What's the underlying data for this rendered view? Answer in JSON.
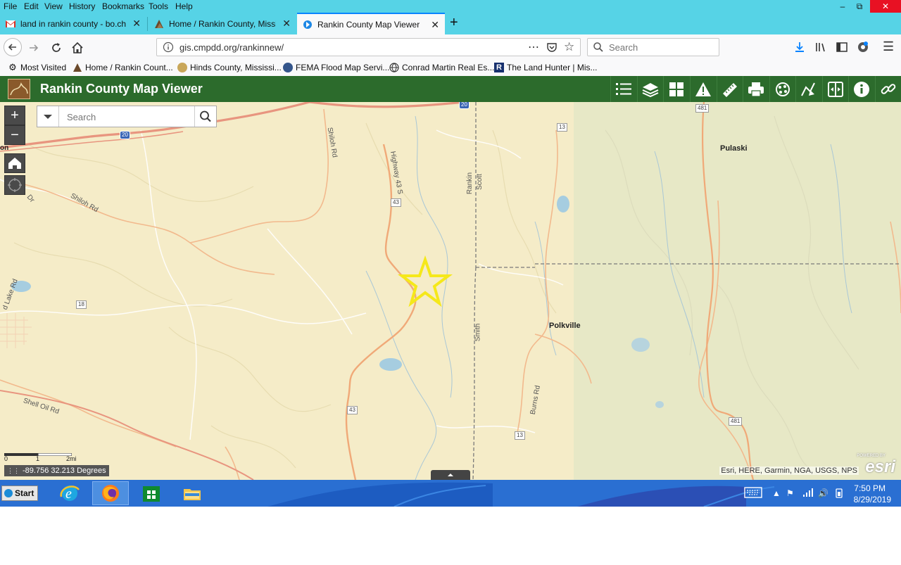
{
  "menubar": {
    "items": [
      "File",
      "Edit",
      "View",
      "History",
      "Bookmarks",
      "Tools",
      "Help"
    ]
  },
  "tabs": [
    {
      "title": "land in rankin county - bo.char",
      "favicon": "gmail-icon",
      "active": false
    },
    {
      "title": "Home / Rankin County, Mississ",
      "favicon": "landwatch-icon",
      "active": false
    },
    {
      "title": "Rankin County Map Viewer",
      "favicon": "map-viewer-icon",
      "active": true
    }
  ],
  "navbar": {
    "url": "gis.cmpdd.org/rankinnew/",
    "search_placeholder": "Search"
  },
  "bookmarks": [
    {
      "label": "Most Visited",
      "icon": "gear-icon"
    },
    {
      "label": "Home / Rankin Count...",
      "icon": "landwatch-icon"
    },
    {
      "label": "Hinds County, Mississi...",
      "icon": "seal-icon"
    },
    {
      "label": "FEMA Flood Map Servi...",
      "icon": "fema-icon"
    },
    {
      "label": "Conrad Martin Real Es...",
      "icon": "globe-icon"
    },
    {
      "label": "The Land Hunter | Mis...",
      "icon": "r-logo-icon"
    }
  ],
  "app": {
    "title": "Rankin County Map Viewer",
    "header_color": "#2c6b2c",
    "tools": [
      "legend-icon",
      "layers-icon",
      "basemap-gallery-icon",
      "warning-icon",
      "measure-icon",
      "print-icon",
      "draw-icon",
      "select-icon",
      "swipe-icon",
      "info-icon",
      "link-icon"
    ]
  },
  "map": {
    "search_placeholder": "Search",
    "zoom_in": "+",
    "zoom_out": "−",
    "labels": {
      "shiloh_rd_v": "Shiloh Rd",
      "shiloh_rd": "Shiloh Rd",
      "highway_43s": "Highway 43 S",
      "rankin": "Rankin",
      "scott": "Scott",
      "smith": "Smith",
      "burns_rd": "Burns Rd",
      "shell_oil_rd": "Shell Oil Rd",
      "lake_rd": "d Lake Rd",
      "dr": "Dr",
      "on": "on"
    },
    "towns": {
      "pulaski": "Pulaski",
      "polkville": "Polkville"
    },
    "shields": {
      "i20_a": "20",
      "i20_b": "20",
      "r13_a": "13",
      "r13_b": "13",
      "r43_a": "43",
      "r43_b": "43",
      "r18": "18",
      "r481_a": "481",
      "r481_b": "481"
    },
    "scale": {
      "zero": "0",
      "one": "1",
      "two": "2mi"
    },
    "coordinates": "-89.756 32.213 Degrees",
    "attribution": "Esri, HERE, Garmin, NGA, USGS, NPS",
    "esri_powered": "POWERED BY",
    "esri_logo": "esri",
    "marker_color": "#f5e81a"
  },
  "taskbar": {
    "start_label": "Start",
    "apps": [
      "ie-icon",
      "firefox-icon",
      "store-icon",
      "file-explorer-icon"
    ],
    "time": "7:50 PM",
    "date": "8/29/2019"
  }
}
